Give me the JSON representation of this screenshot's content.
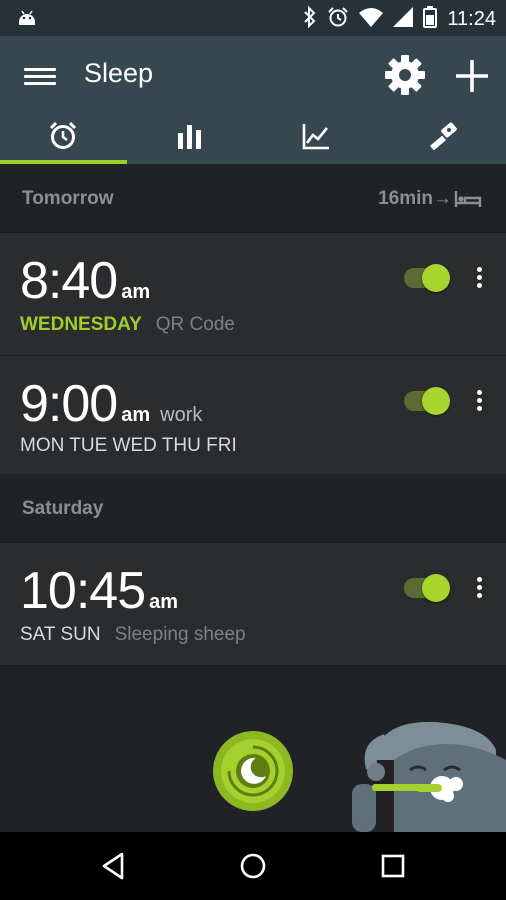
{
  "status_bar": {
    "time": "11:24",
    "icons": [
      "android-debug-icon",
      "bluetooth-icon",
      "alarm-clock-icon",
      "wifi-icon",
      "cell-signal-icon",
      "battery-icon"
    ]
  },
  "app_bar": {
    "title": "Sleep",
    "tabs": [
      {
        "icon": "alarm-clock-icon",
        "active": true
      },
      {
        "icon": "bar-chart-icon",
        "active": false
      },
      {
        "icon": "line-chart-icon",
        "active": false
      },
      {
        "icon": "magic-wand-icon",
        "active": false
      }
    ]
  },
  "sections": {
    "tomorrow": {
      "label": "Tomorrow",
      "hint": "16min→"
    },
    "saturday": {
      "label": "Saturday"
    }
  },
  "alarms": [
    {
      "time": "8:40",
      "ampm": "am",
      "label": "",
      "days": "WEDNESDAY",
      "sub": "QR Code",
      "enabled": true
    },
    {
      "time": "9:00",
      "ampm": "am",
      "label": "work",
      "days": "MON TUE WED THU FRI",
      "sub": "",
      "enabled": true
    },
    {
      "time": "10:45",
      "ampm": "am",
      "label": "",
      "days": "SAT SUN",
      "sub": "Sleeping sheep",
      "enabled": true
    }
  ],
  "colors": {
    "accent": "#9fcd2a",
    "app_bar": "#37474f",
    "status_bar": "#263238",
    "background": "#202226",
    "card": "#2b2c2e"
  }
}
